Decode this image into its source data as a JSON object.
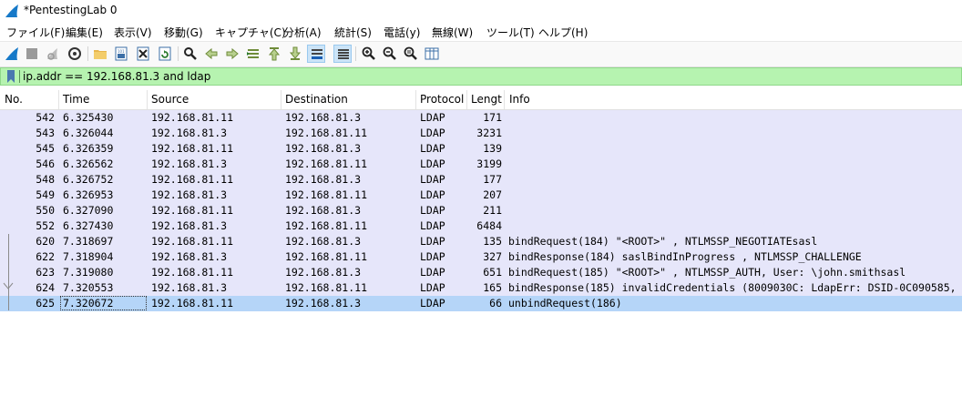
{
  "window": {
    "title": "*PentestingLab 0",
    "app_icon": "wireshark-fin-icon"
  },
  "menu": [
    "ファイル(F)",
    "編集(E)",
    "表示(V)",
    "移動(G)",
    "キャプチャ(C)",
    "分析(A)",
    "統計(S)",
    "電話(y)",
    "無線(W)",
    "ツール(T)",
    "ヘルプ(H)"
  ],
  "toolbar": {
    "icons": [
      "start-capture-icon",
      "stop-capture-icon",
      "restart-capture-icon",
      "capture-options-icon",
      "open-file-icon",
      "save-file-icon",
      "close-file-icon",
      "reload-file-icon",
      "find-packet-icon",
      "go-back-icon",
      "go-forward-icon",
      "go-to-packet-icon",
      "go-first-icon",
      "go-last-icon",
      "autoscroll-icon",
      "colorize-icon",
      "zoom-in-icon",
      "zoom-out-icon",
      "normal-size-icon",
      "resize-columns-icon"
    ]
  },
  "filter": {
    "value": "ip.addr == 192.168.81.3 and ldap",
    "bookmark_icon": "filter-bookmark-icon",
    "bg_color": "#b6f3b0"
  },
  "columns": [
    "No.",
    "Time",
    "Source",
    "Destination",
    "Protocol",
    "Length",
    "Info"
  ],
  "colors": {
    "row_bg": "#e6e6fa",
    "selected_bg": "#b5d5f8"
  },
  "packets": [
    {
      "no": "542",
      "time": "6.325430",
      "src": "192.168.81.11",
      "dst": "192.168.81.3",
      "proto": "LDAP",
      "len": "171",
      "info": ""
    },
    {
      "no": "543",
      "time": "6.326044",
      "src": "192.168.81.3",
      "dst": "192.168.81.11",
      "proto": "LDAP",
      "len": "3231",
      "info": ""
    },
    {
      "no": "545",
      "time": "6.326359",
      "src": "192.168.81.11",
      "dst": "192.168.81.3",
      "proto": "LDAP",
      "len": "139",
      "info": ""
    },
    {
      "no": "546",
      "time": "6.326562",
      "src": "192.168.81.3",
      "dst": "192.168.81.11",
      "proto": "LDAP",
      "len": "3199",
      "info": ""
    },
    {
      "no": "548",
      "time": "6.326752",
      "src": "192.168.81.11",
      "dst": "192.168.81.3",
      "proto": "LDAP",
      "len": "177",
      "info": ""
    },
    {
      "no": "549",
      "time": "6.326953",
      "src": "192.168.81.3",
      "dst": "192.168.81.11",
      "proto": "LDAP",
      "len": "207",
      "info": ""
    },
    {
      "no": "550",
      "time": "6.327090",
      "src": "192.168.81.11",
      "dst": "192.168.81.3",
      "proto": "LDAP",
      "len": "211",
      "info": ""
    },
    {
      "no": "552",
      "time": "6.327430",
      "src": "192.168.81.3",
      "dst": "192.168.81.11",
      "proto": "LDAP",
      "len": "6484",
      "info": ""
    },
    {
      "no": "620",
      "time": "7.318697",
      "src": "192.168.81.11",
      "dst": "192.168.81.3",
      "proto": "LDAP",
      "len": "135",
      "info": "bindRequest(184) \"<ROOT>\" , NTLMSSP_NEGOTIATEsasl"
    },
    {
      "no": "622",
      "time": "7.318904",
      "src": "192.168.81.3",
      "dst": "192.168.81.11",
      "proto": "LDAP",
      "len": "327",
      "info": "bindResponse(184) saslBindInProgress , NTLMSSP_CHALLENGE"
    },
    {
      "no": "623",
      "time": "7.319080",
      "src": "192.168.81.11",
      "dst": "192.168.81.3",
      "proto": "LDAP",
      "len": "651",
      "info": "bindRequest(185) \"<ROOT>\" , NTLMSSP_AUTH, User: \\john.smithsasl"
    },
    {
      "no": "624",
      "time": "7.320553",
      "src": "192.168.81.3",
      "dst": "192.168.81.11",
      "proto": "LDAP",
      "len": "165",
      "info": "bindResponse(185) invalidCredentials (8009030C: LdapErr: DSID-0C090585,"
    },
    {
      "no": "625",
      "time": "7.320672",
      "src": "192.168.81.11",
      "dst": "192.168.81.3",
      "proto": "LDAP",
      "len": "66",
      "info": "unbindRequest(186)"
    }
  ],
  "selected_index": 12
}
